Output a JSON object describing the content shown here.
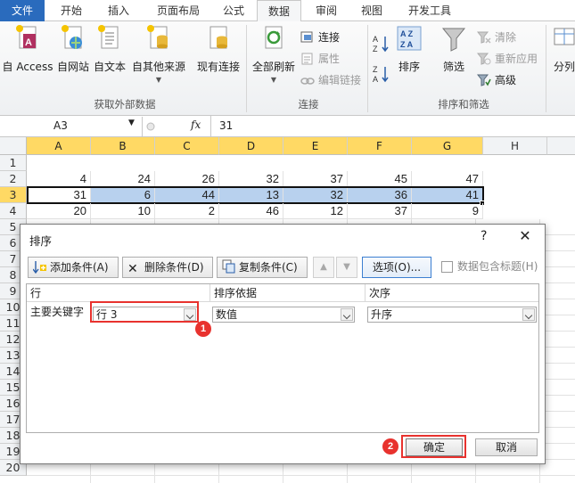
{
  "ribbon": {
    "tabs": [
      "文件",
      "开始",
      "插入",
      "页面布局",
      "公式",
      "数据",
      "审阅",
      "视图",
      "开发工具"
    ],
    "active_tab": "数据",
    "groups": {
      "external": {
        "label": "获取外部数据",
        "buttons": [
          "自 Access",
          "自网站",
          "自文本",
          "自其他来源",
          "现有连接"
        ]
      },
      "connections": {
        "label": "连接",
        "refresh_all": "全部刷新",
        "items": [
          "连接",
          "属性",
          "编辑链接"
        ]
      },
      "sort_filter": {
        "label": "排序和筛选",
        "sort": "排序",
        "filter": "筛选",
        "items": [
          "清除",
          "重新应用",
          "高级"
        ]
      },
      "tools": {
        "split": "分列"
      }
    }
  },
  "formula_bar": {
    "name_box": "A3",
    "fx": "fx",
    "value": "31"
  },
  "grid": {
    "columns": [
      "A",
      "B",
      "C",
      "D",
      "E",
      "F",
      "G",
      "H"
    ],
    "rows": [
      "1",
      "2",
      "3",
      "4",
      "5",
      "6",
      "7",
      "8",
      "9",
      "10",
      "11",
      "12",
      "13",
      "14",
      "15",
      "16",
      "17",
      "18",
      "19",
      "20"
    ],
    "row2": [
      "4",
      "24",
      "26",
      "32",
      "37",
      "45",
      "47"
    ],
    "row3": [
      "31",
      "6",
      "44",
      "13",
      "32",
      "36",
      "41"
    ],
    "row4": [
      "20",
      "10",
      "2",
      "46",
      "12",
      "37",
      "9"
    ]
  },
  "sort_dialog": {
    "title": "排序",
    "help": "?",
    "close": "✕",
    "toolbar": {
      "add": "添加条件(A)",
      "delete": "删除条件(D)",
      "copy": "复制条件(C)",
      "options": "选项(O)...",
      "header_checkbox": "数据包含标题(H)"
    },
    "columns": {
      "key": "行",
      "sort_on": "排序依据",
      "order": "次序"
    },
    "rule": {
      "label": "主要关键字",
      "key": "行 3",
      "sort_on": "数值",
      "order": "升序"
    },
    "ok": "确定",
    "cancel": "取消"
  },
  "annotations": {
    "marker1": "1",
    "marker2": "2",
    "color": "#e8322e"
  }
}
